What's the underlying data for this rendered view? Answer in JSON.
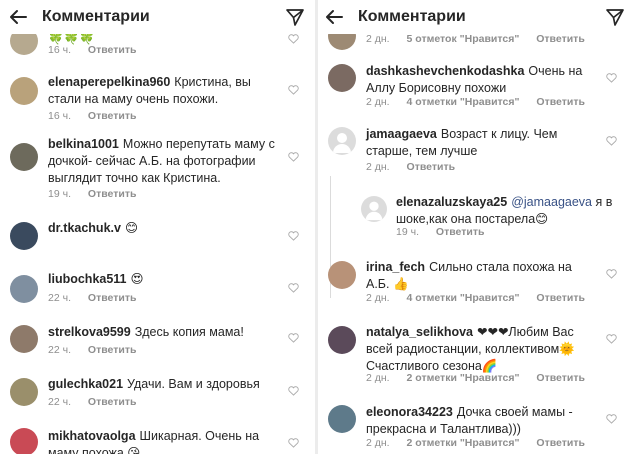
{
  "header": {
    "title": "Комментарии",
    "back_icon": "arrow-left-icon",
    "send_icon": "paper-plane-icon"
  },
  "left": {
    "top_partial": {
      "time": "16 ч.",
      "reply": "Ответить"
    },
    "comments": [
      {
        "user": "elenaperepelkina960",
        "text": "Кристина, вы стали на маму очень похожи.",
        "time": "16 ч.",
        "reply": "Ответить",
        "avatar_color": "#b9a27b"
      },
      {
        "user": "belkina1001",
        "text": "Можно перепутать маму с дочкой- сейчас А.Б. на фотографии выглядит точно как Кристина.",
        "time": "19 ч.",
        "reply": "Ответить",
        "avatar_color": "#6d6a5c"
      },
      {
        "user": "dr.tkachuk.v",
        "text": "😊",
        "time": "",
        "reply": "",
        "avatar_color": "#3a4a5e"
      },
      {
        "user": "liubochka511",
        "text": "😍",
        "time": "22 ч.",
        "reply": "Ответить",
        "avatar_color": "#7f8fa0"
      },
      {
        "user": "strelkova9599",
        "text": "Здесь копия мама!",
        "time": "22 ч.",
        "reply": "Ответить",
        "avatar_color": "#8e7a6a"
      },
      {
        "user": "gulechka021",
        "text": "Удачи. Вам и здоровья",
        "time": "22 ч.",
        "reply": "Ответить",
        "avatar_color": "#9a8f6b"
      },
      {
        "user": "mikhatovaolga",
        "text": "Шикарная. Очень на маму похожа 😘",
        "time": "",
        "reply": "",
        "avatar_color": "#c94a55"
      }
    ]
  },
  "right": {
    "top_partial": {
      "time": "2 дн.",
      "likes": "5 отметок \"Нравится\"",
      "reply": "Ответить"
    },
    "comments": [
      {
        "user": "dashkashevchenkodashka",
        "text": "Очень на Аллу Борисовну похожи",
        "time": "2 дн.",
        "likes": "4 отметки \"Нравится\"",
        "reply": "Ответить",
        "avatar_color": "#7b6a62"
      },
      {
        "user": "jamaagaeva",
        "text": "Возраст к лицу. Чем старше, тем лучше",
        "time": "2 дн.",
        "likes": "",
        "reply": "Ответить",
        "avatar_color": "#d8d8d8"
      },
      {
        "user": "elenazaluzskaya25",
        "mention": "@jamaagaeva",
        "text": "я в шоке,как она постарела😊",
        "time": "19 ч.",
        "likes": "",
        "reply": "Ответить",
        "avatar_color": "#d8d8d8"
      },
      {
        "user": "irina_fech",
        "text": "Сильно стала похожа на А.Б. 👍",
        "time": "2 дн.",
        "likes": "4 отметки \"Нравится\"",
        "reply": "Ответить",
        "avatar_color": "#b89278"
      },
      {
        "user": "natalya_selikhova",
        "text": "❤❤❤Любим Вас всей радиостанции, коллективом🌞 Счастливого сезона🌈",
        "time": "2 дн.",
        "likes": "2 отметки \"Нравится\"",
        "reply": "Ответить",
        "avatar_color": "#5b4a5a"
      },
      {
        "user": "eleonora34223",
        "text": "Дочка своей мамы - прекрасна и Талантлива)))",
        "time": "2 дн.",
        "likes": "2 отметки \"Нравится\"",
        "reply": "Ответить",
        "avatar_color": "#5e7a8a"
      }
    ]
  }
}
